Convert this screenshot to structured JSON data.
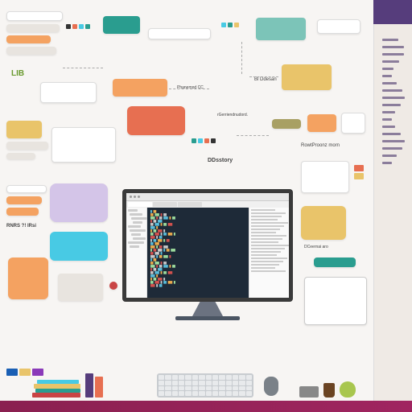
{
  "meta": {
    "description": "Illustration/infographic of a desktop computer workstation with a code editor on screen, surrounded by a mind-map style web of labeled concept nodes, icons, books, keyboard and mouse. Text on most nodes is stylized/illegible placeholder-like glyphs.",
    "legible_labels": [
      "LIB",
      "DDsstory",
      "Bl Ddessr"
    ],
    "monitor": {
      "editor_theme": "dark",
      "panels": [
        "file-tree",
        "code-editor",
        "docs-preview"
      ]
    }
  },
  "nodes": {
    "lib": "LIB",
    "dds": "DDsstory",
    "bld": "Bl Ddesan"
  },
  "sidebar_line_count": 18,
  "ide": {
    "tree_items": 10,
    "code_lines": 24,
    "doc_lines": 20
  }
}
